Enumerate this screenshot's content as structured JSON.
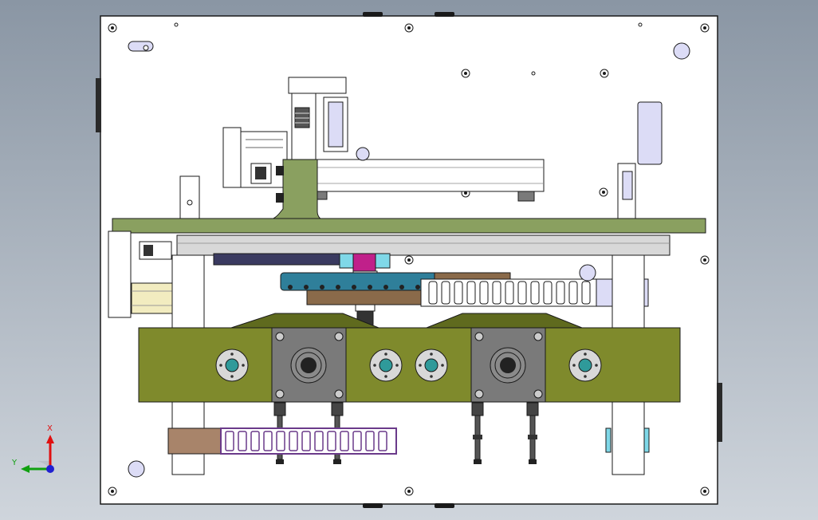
{
  "viewport": {
    "background_top": "#8a96a4",
    "background_bottom": "#cfd5dc"
  },
  "colors": {
    "plate": "#ffffff",
    "outline": "#1a1a1a",
    "olive_block": "#7f8a2c",
    "olive_dark": "#5f6a1e",
    "green_bracket": "#8aa060",
    "rail_gray": "#d8d8d8",
    "motor_gray": "#7a7a7a",
    "teal_manifold": "#2f7f9a",
    "magenta_gripper": "#c0208a",
    "brown_block": "#8a6a4a",
    "tan_block": "#a8846a",
    "purple_chain": "#6a3a8a",
    "light_lavender": "#dcdcf6",
    "cream_motor": "#f2ecc0",
    "cyan_accent": "#7fd8e8",
    "dark_navy": "#3a3a60"
  },
  "triad": {
    "x_label": "X",
    "y_label": "Y",
    "x_color": "#e01010",
    "y_color": "#10a010",
    "z_color": "#2020d0"
  }
}
